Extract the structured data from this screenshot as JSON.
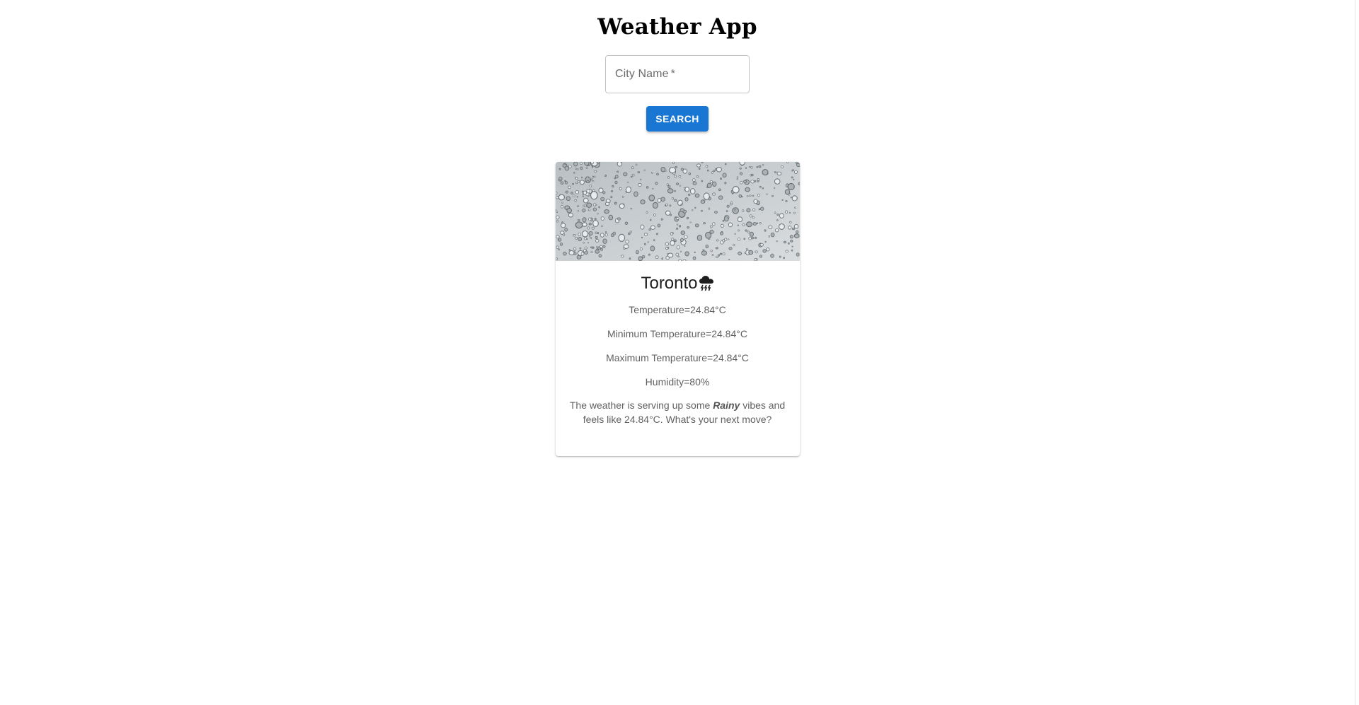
{
  "app": {
    "title": "Weather App"
  },
  "search": {
    "label": "City Name",
    "required_mark": "*",
    "value": "",
    "button_label": "SEARCH"
  },
  "card": {
    "image_alt": "rain drops on glass",
    "city": "Toronto",
    "weather_icon": "thunderstorm-cloud-icon",
    "temperature": "Temperature=24.84°C",
    "min_temperature": "Minimum Temperature=24.84°C",
    "max_temperature": "Maximum Temperature=24.84°C",
    "humidity": "Humidity=80%",
    "description_prefix": "The weather is serving up some",
    "condition": "Rainy",
    "description_suffix": "vibes and feels like 24.84°C. What's your next move?"
  },
  "colors": {
    "primary": "#1976d2",
    "text_secondary": "#616161"
  }
}
